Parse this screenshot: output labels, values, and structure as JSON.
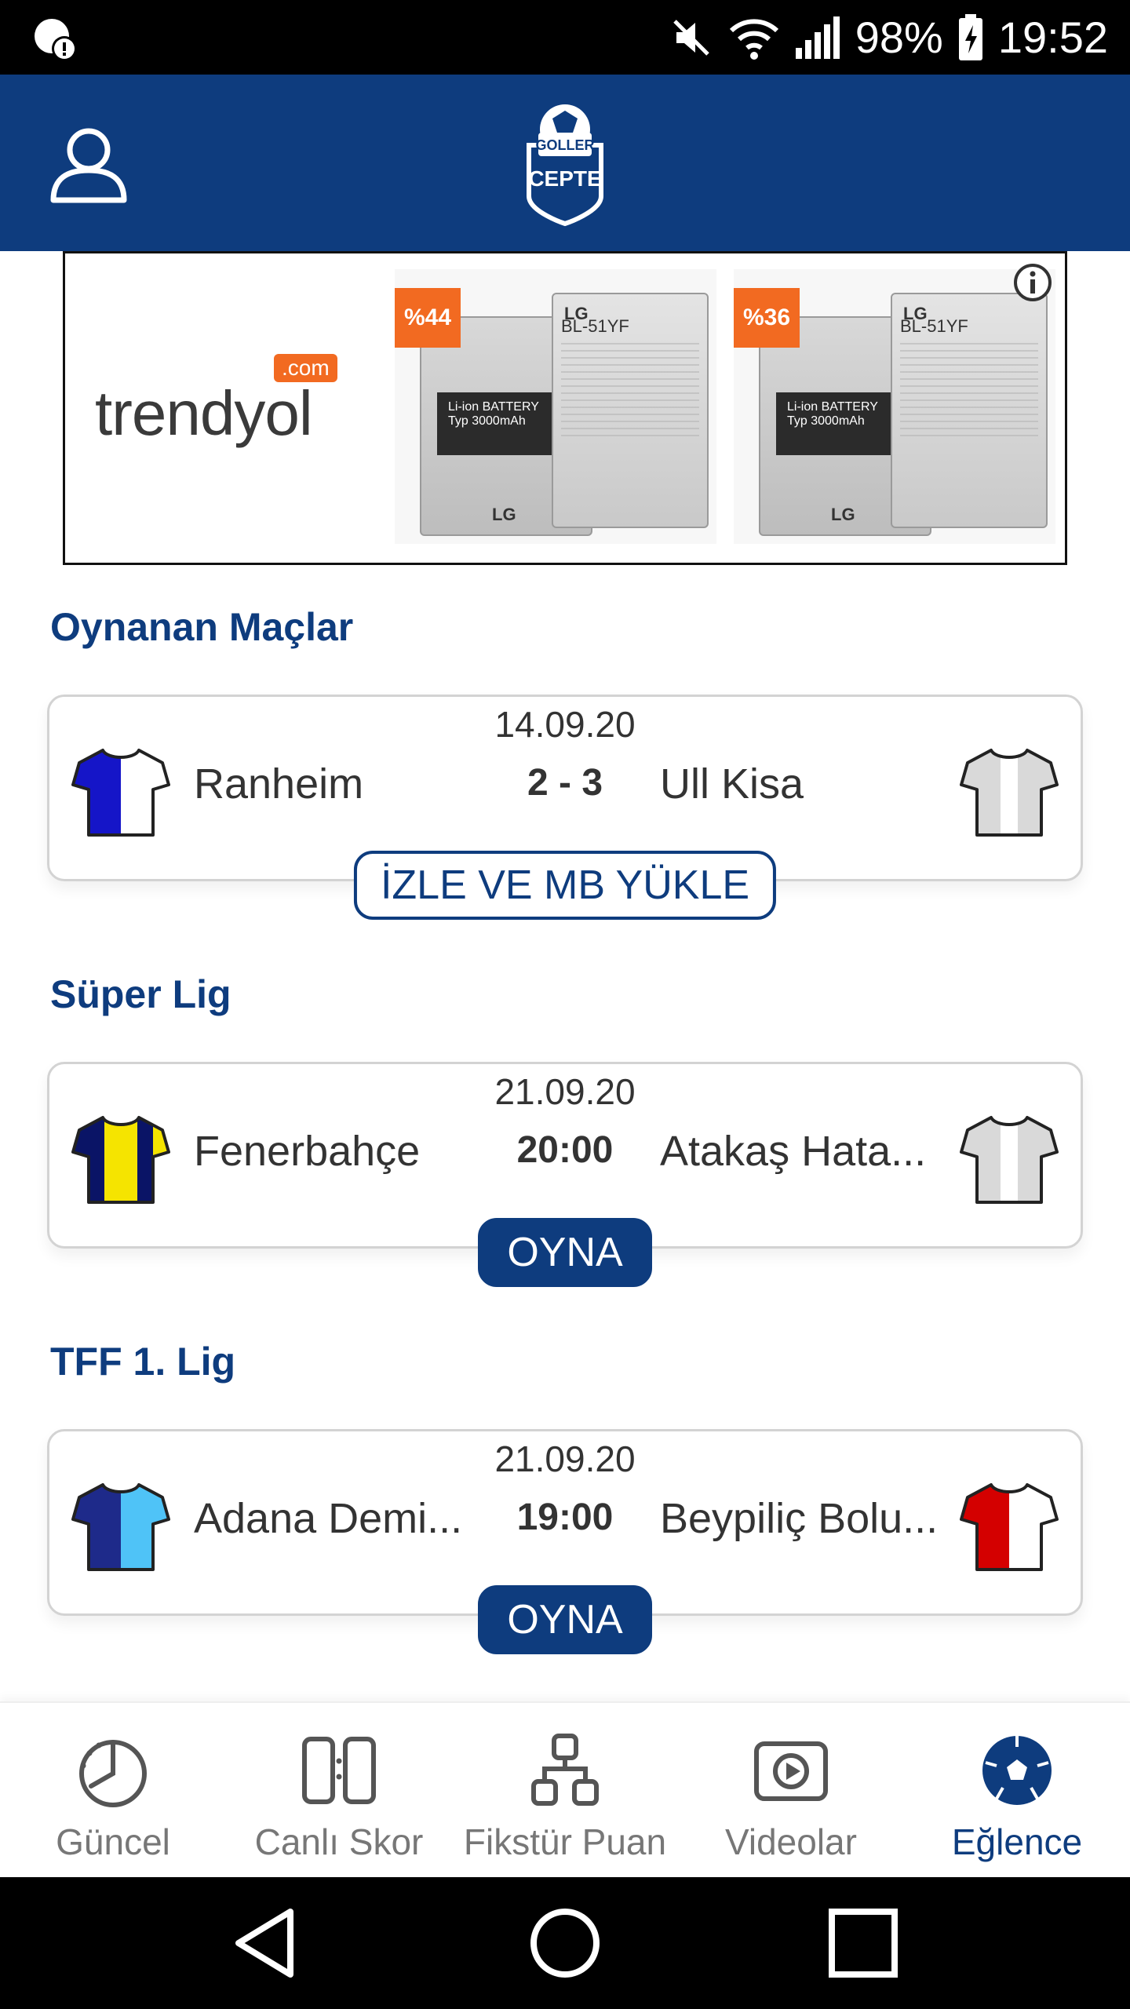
{
  "status_bar": {
    "battery_percent": "98%",
    "time": "19:52"
  },
  "app_bar": {
    "logo_line1": "GOLLER",
    "logo_line2": "CEPTE"
  },
  "ad": {
    "brand": "trendyol",
    "brand_suffix": ".com",
    "products": [
      {
        "discount": "%44",
        "model": "BL-51YF",
        "brand": "LG",
        "label": "Li-ion BATTERY",
        "capacity": "Typ 3000mAh"
      },
      {
        "discount": "%36",
        "model": "BL-51YF",
        "brand": "LG",
        "label": "Li-ion BATTERY",
        "capacity": "Typ 3000mAh"
      }
    ]
  },
  "sections": [
    {
      "title": "Oynanan Maçlar",
      "match": {
        "date": "14.09.20",
        "home": "Ranheim",
        "away": "Ull Kisa",
        "center": "2 - 3",
        "action": "İZLE VE MB YÜKLE"
      }
    },
    {
      "title": "Süper Lig",
      "match": {
        "date": "21.09.20",
        "home": "Fenerbahçe",
        "away": "Atakaş Hata...",
        "center": "20:00",
        "action": "OYNA"
      }
    },
    {
      "title": "TFF 1. Lig",
      "match": {
        "date": "21.09.20",
        "home": "Adana Demi...",
        "away": "Beypiliç Bolu...",
        "center": "19:00",
        "action": "OYNA"
      }
    }
  ],
  "bottom_nav": [
    {
      "label": "Güncel",
      "icon": "clock-icon"
    },
    {
      "label": "Canlı Skor",
      "icon": "scoreboard-icon"
    },
    {
      "label": "Fikstür Puan",
      "icon": "bracket-icon"
    },
    {
      "label": "Videolar",
      "icon": "play-video-icon"
    },
    {
      "label": "Eğlence",
      "icon": "soccer-ball-icon",
      "active": true
    }
  ],
  "colors": {
    "primary": "#0e3c7e",
    "ad_accent": "#f26a21"
  }
}
